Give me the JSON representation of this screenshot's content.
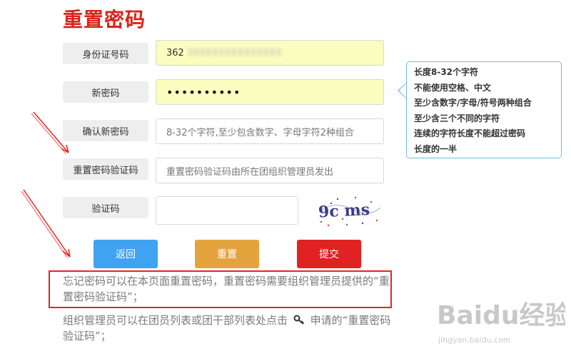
{
  "page": {
    "title": "重置密码"
  },
  "form": {
    "id_label": "身份证号码",
    "id_value_visible": "362",
    "id_value_blurred": "3XXXXXXXXXXXXXX",
    "newpwd_label": "新密码",
    "newpwd_value": "••••••••••",
    "confirm_label": "确认新密码",
    "confirm_placeholder": "8-32个字符,至少包含数字、字母字符2种组合",
    "resetcode_label": "重置密码验证码",
    "resetcode_placeholder": "重置密码验证码由所在团组织管理员发出",
    "captcha_label": "验证码",
    "captcha_value": "",
    "captcha_image_text": "9c ms"
  },
  "tooltip": {
    "lines": [
      "长度8-32个字符",
      "不能使用空格、中文",
      "至少含数字/字母/符号两种组合",
      "至少含三个不同的字符",
      "连续的字符长度不能超过密码",
      "长度的一半"
    ]
  },
  "buttons": {
    "back": "返回",
    "reset": "重置",
    "submit": "提交"
  },
  "notes": {
    "note1": "忘记密码可以在本页面重置密码，重置密码需要组织管理员提供的“重置密码验证码”；",
    "note2_part1": "组织管理员可以在团员列表或团干部列表处点击",
    "note2_part2": "申请的“重置密码验证码”；"
  },
  "watermark": {
    "brand": "Baidu经验",
    "url": "jingyan.baidu.com"
  },
  "colors": {
    "title": "#d9231c",
    "back_button": "#3fa3f1",
    "reset_button": "#e5a33d",
    "submit_button": "#e02222",
    "tooltip_border": "#74bde0",
    "annotation_red": "#e12626",
    "filled_field": "#fafdbd"
  },
  "icons": {
    "key": "key-icon",
    "captcha": "captcha-image"
  }
}
